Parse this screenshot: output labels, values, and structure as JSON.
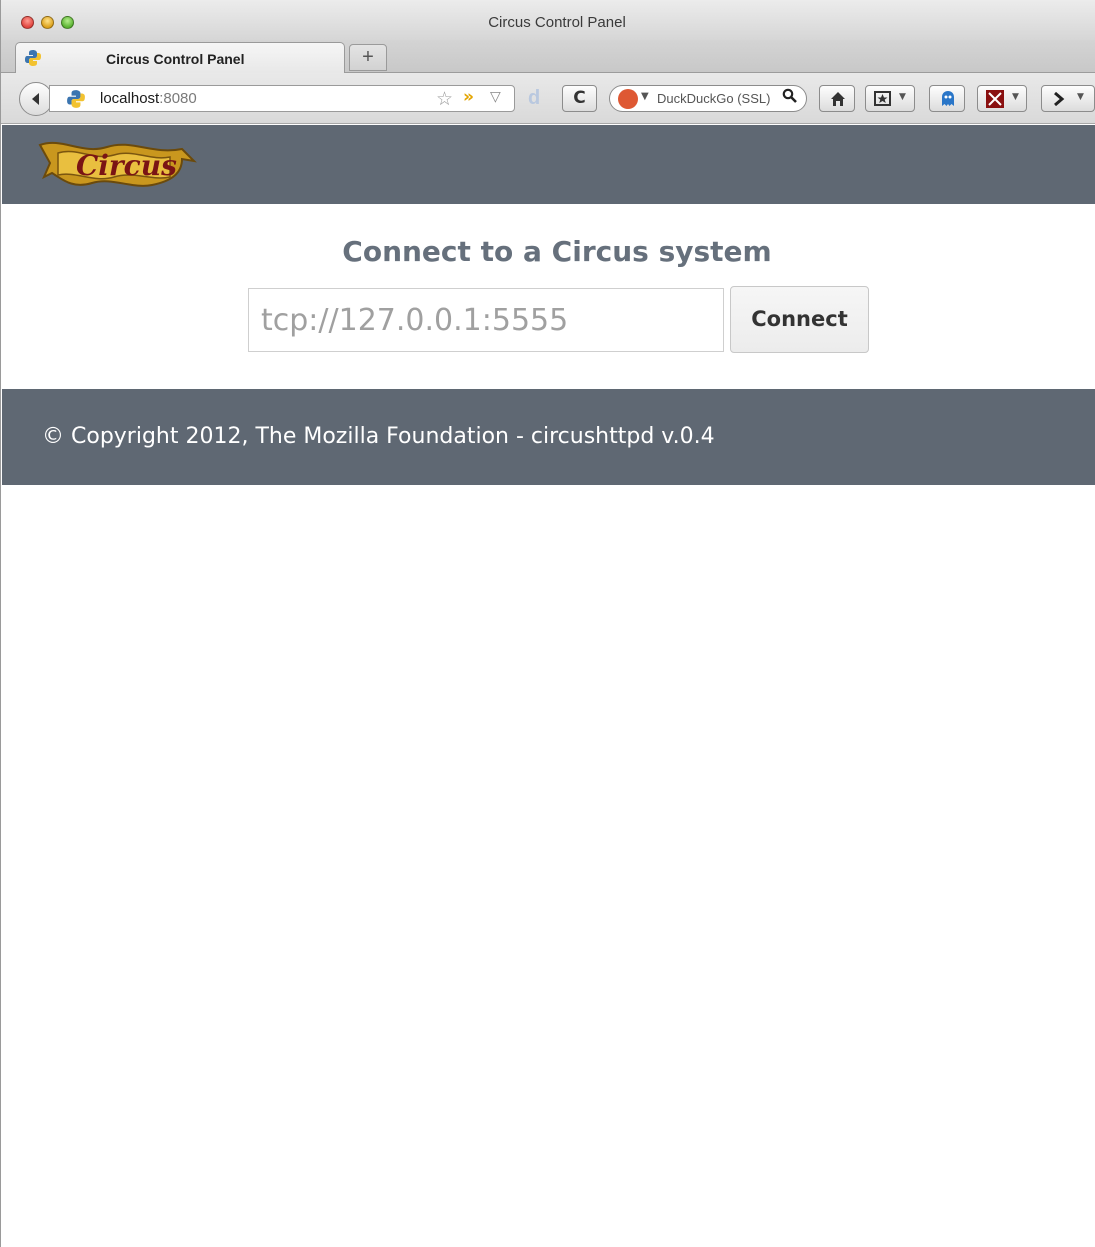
{
  "window": {
    "title": "Circus Control Panel"
  },
  "tabs": [
    {
      "label": "Circus Control Panel",
      "active": true
    }
  ],
  "new_tab_label": "+",
  "navbar": {
    "url_host": "localhost",
    "url_port": ":8080",
    "search_placeholder": "DuckDuckGo (SSL)",
    "reload_glyph": "C"
  },
  "page": {
    "heading": "Connect to a Circus system",
    "endpoint_placeholder": "tcp://127.0.0.1:5555",
    "connect_label": "Connect",
    "footer": "© Copyright 2012, The Mozilla Foundation - circushttpd v.0.4"
  },
  "colors": {
    "header_bg": "#5f6873",
    "heading": "#66707c"
  },
  "icons": {
    "logo": "circus-banner-logo"
  }
}
